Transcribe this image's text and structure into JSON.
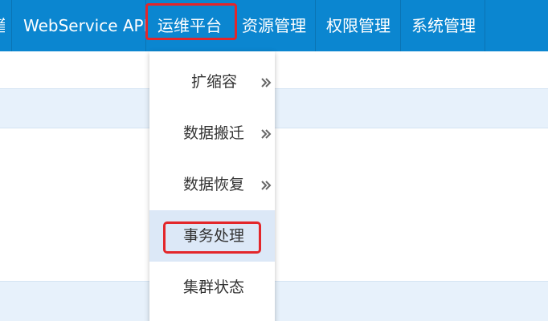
{
  "nav": {
    "partial_item": "管",
    "items": [
      "WebService API",
      "运维平台",
      "资源管理",
      "权限管理",
      "系统管理"
    ]
  },
  "dropdown": {
    "items": [
      {
        "label": "扩缩容",
        "has_submenu": true
      },
      {
        "label": "数据搬迁",
        "has_submenu": true
      },
      {
        "label": "数据恢复",
        "has_submenu": true
      },
      {
        "label": "事务处理",
        "has_submenu": false,
        "selected": true
      },
      {
        "label": "集群状态",
        "has_submenu": false
      }
    ]
  },
  "colors": {
    "nav_bg": "#0b86d0",
    "highlight": "#e3262a",
    "row_stripe": "#e7f1fb",
    "menu_active": "#dce8f7"
  },
  "icons": {
    "submenu": "double-chevron-right-icon"
  }
}
